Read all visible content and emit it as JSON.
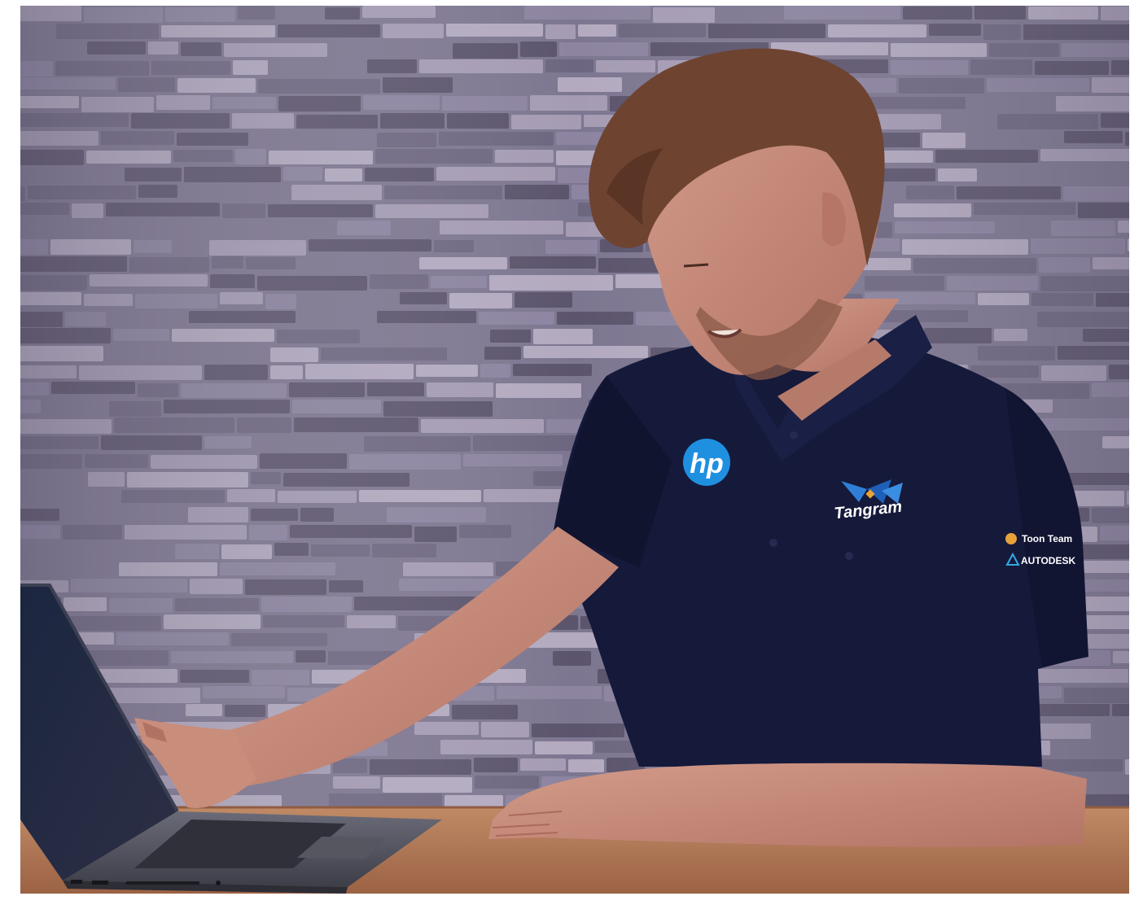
{
  "photo": {
    "subject": "person-at-laptop",
    "colors": {
      "wall_dark": "#5b546c",
      "wall_light": "#a59cb4",
      "wall_mid": "#7d7690",
      "shirt": "#15193a",
      "skin": "#c58c7c",
      "hair": "#6e4330",
      "table": "#b07553",
      "laptop": "#4b4c57",
      "hp_blue": "#1f8fe0"
    },
    "logos": {
      "chest_logo": "hp",
      "pocket_logo": "Tangram",
      "sleeve_logo_1": "Toon Team",
      "sleeve_logo_2": "AUTODESK"
    }
  }
}
